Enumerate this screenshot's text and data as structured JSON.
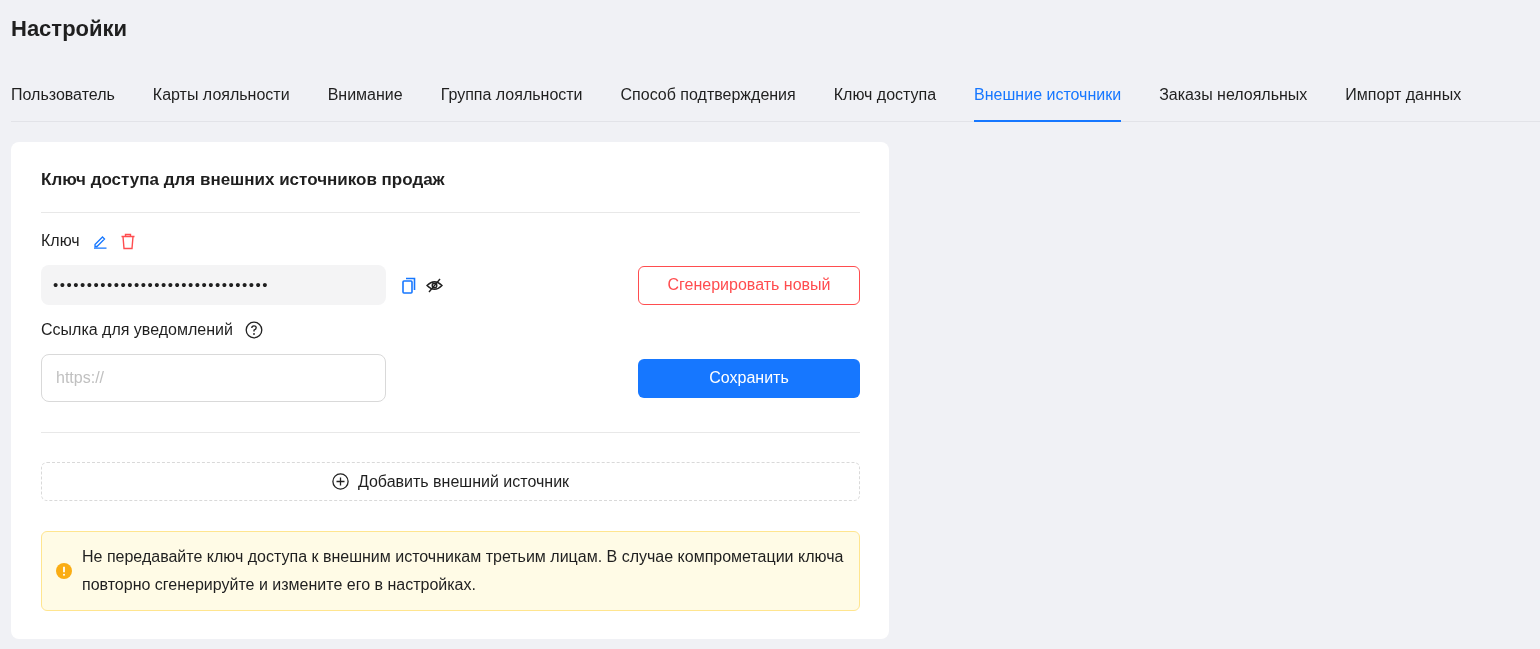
{
  "page_title": "Настройки",
  "tabs": [
    {
      "label": "Пользователь",
      "selected": false
    },
    {
      "label": "Карты лояльности",
      "selected": false
    },
    {
      "label": "Внимание",
      "selected": false
    },
    {
      "label": "Группа лояльности",
      "selected": false
    },
    {
      "label": "Способ подтверждения",
      "selected": false
    },
    {
      "label": "Ключ доступа",
      "selected": false
    },
    {
      "label": "Внешние источники",
      "selected": true
    },
    {
      "label": "Заказы нелояльных",
      "selected": false
    },
    {
      "label": "Импорт данных",
      "selected": false
    }
  ],
  "card": {
    "title": "Ключ доступа для внешних источников продаж",
    "key_label": "Ключ",
    "key_value": "••••••••••••••••••••••••••••••••",
    "generate_button": "Сгенерировать новый",
    "webhook_label": "Ссылка для уведомлений",
    "webhook_placeholder": "https://",
    "save_button": "Сохранить",
    "add_source_button": "Добавить внешний источник",
    "warning": "Не передавайте ключ доступа к внешним источникам третьим лицам. В случае компрометации ключа повторно сгенерируйте и измените его в настройках."
  }
}
